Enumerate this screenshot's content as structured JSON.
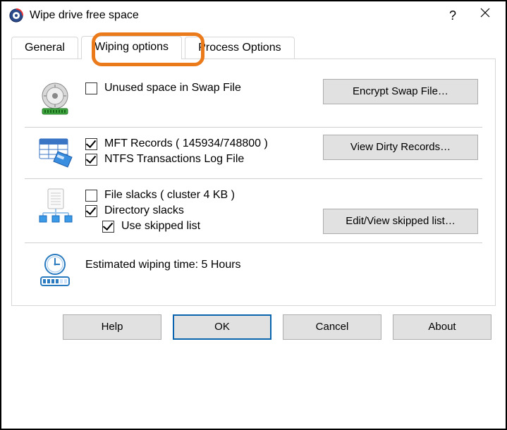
{
  "window": {
    "title": "Wipe drive free space",
    "help_glyph": "?",
    "close_glyph": "✕"
  },
  "tabs": {
    "general": "General",
    "wiping_options": "Wiping options",
    "process_options": "Process Options"
  },
  "sections": {
    "swap": {
      "unused_label": "Unused space in Swap File",
      "unused_checked": false,
      "button": "Encrypt Swap File…"
    },
    "mft": {
      "records_label": "MFT Records ( 145934/748800 )",
      "records_checked": true,
      "ntfs_log_label": "NTFS Transactions Log File",
      "ntfs_log_checked": true,
      "button": "View Dirty Records…"
    },
    "slacks": {
      "file_label": "File slacks ( cluster 4 KB )",
      "file_checked": false,
      "dir_label": "Directory slacks",
      "dir_checked": true,
      "skipped_label": "Use skipped list",
      "skipped_checked": true,
      "button": "Edit/View skipped list…"
    },
    "time": {
      "prefix": "Estimated wiping time:  ",
      "value": "5 Hours"
    }
  },
  "footer": {
    "help": "Help",
    "ok": "OK",
    "cancel": "Cancel",
    "about": "About"
  }
}
